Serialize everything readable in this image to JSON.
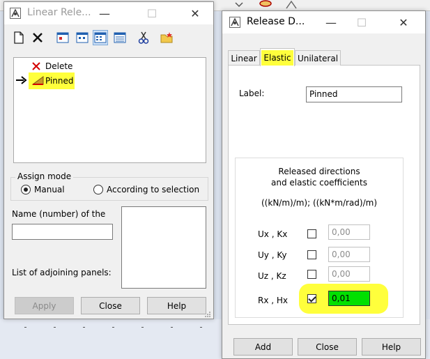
{
  "left_window": {
    "title": "Linear Rele...",
    "tree": {
      "items": [
        {
          "label": "Delete"
        },
        {
          "label": "Pinned"
        }
      ]
    },
    "assign_mode": {
      "title": "Assign mode",
      "options": [
        {
          "label": "Manual",
          "checked": true
        },
        {
          "label": "According to selection",
          "checked": false
        }
      ]
    },
    "name_label": "Name (number) of the",
    "name_value": "",
    "adjoining_label": "List of adjoining panels:",
    "buttons": {
      "apply": "Apply",
      "close": "Close",
      "help": "Help"
    },
    "window_controls": {
      "minimize": "—",
      "maximize": "☐",
      "close": "✕"
    }
  },
  "right_window": {
    "title": "Release D...",
    "tabs": [
      {
        "label": "Linear",
        "selected": false
      },
      {
        "label": "Elastic",
        "selected": true
      },
      {
        "label": "Unilateral",
        "selected": false
      }
    ],
    "label_caption": "Label:",
    "label_value": "Pinned",
    "group_heading_line1": "Released directions",
    "group_heading_line2": "and elastic coefficients",
    "units": "((kN/m)/m);  ((kN*m/rad)/m)",
    "directions": [
      {
        "label": "Ux , Kx",
        "checked": false,
        "value": "0,00"
      },
      {
        "label": "Uy , Ky",
        "checked": false,
        "value": "0,00"
      },
      {
        "label": "Uz , Kz",
        "checked": false,
        "value": "0,00"
      },
      {
        "label": "Rx , Hx",
        "checked": true,
        "value": "0,01"
      }
    ],
    "buttons": {
      "add": "Add",
      "close": "Close",
      "help": "Help"
    },
    "window_controls": {
      "minimize": "—",
      "maximize": "☐",
      "close": "✕"
    }
  },
  "colors": {
    "highlight": "#ffff3c",
    "active_field": "#00e000",
    "delete_icon": "#d40000"
  }
}
